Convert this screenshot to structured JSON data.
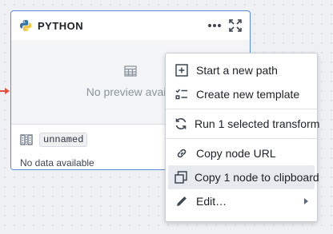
{
  "node": {
    "title": "PYTHON",
    "preview_text": "No preview availa",
    "dataset_name": "unnamed",
    "status": "No data available",
    "icons": [
      "python-icon",
      "more-icon",
      "expand-icon",
      "table-icon",
      "dataset-icon"
    ]
  },
  "menu": {
    "items": [
      {
        "label": "Start a new path",
        "icon": "add-box-icon"
      },
      {
        "label": "Create new template",
        "icon": "checklist-icon"
      },
      {
        "label": "Run 1 selected transform",
        "icon": "refresh-icon"
      },
      {
        "label": "Copy node URL",
        "icon": "link-icon"
      },
      {
        "label": "Copy 1 node to clipboard",
        "icon": "duplicate-icon"
      },
      {
        "label": "Edit…",
        "icon": "pencil-icon"
      }
    ]
  },
  "colors": {
    "node_border": "#5b8bd6",
    "edge": "#e0523f",
    "menu_highlight": "#e7ebef"
  }
}
